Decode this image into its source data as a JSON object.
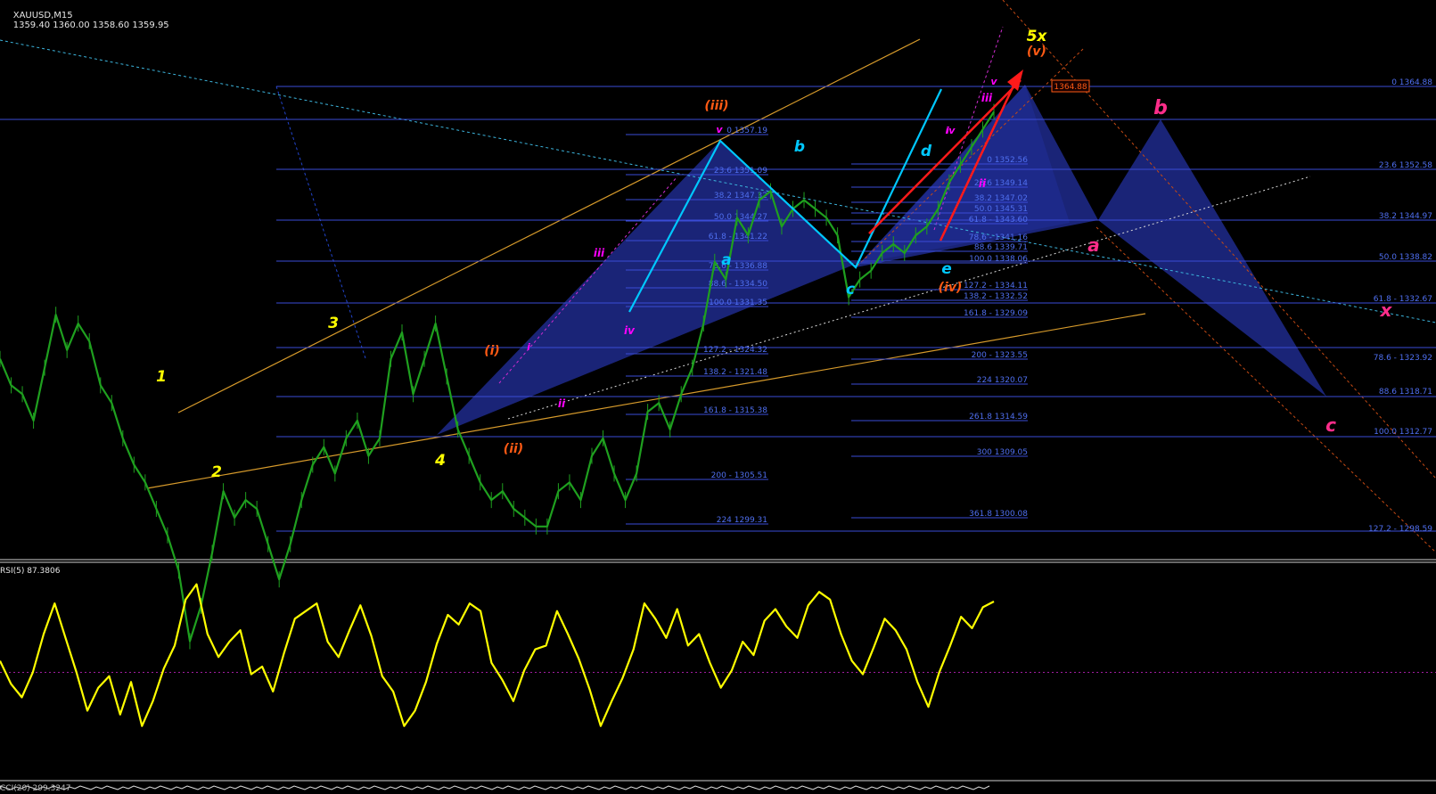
{
  "header": {
    "symbol_tf": "XAUUSD,M15",
    "ohlc": "1359.40 1360.00 1358.60 1359.95"
  },
  "rsi": {
    "label": "RSI(5) 87.3806"
  },
  "cci": {
    "label": "CCI(20) 299.3247"
  },
  "colors": {
    "background": "#000000",
    "candles": "#1fa01f",
    "fib": "#3a4bd6",
    "fib_text": "#4f6ff0",
    "fill": "#1e2a8c",
    "yellow_wave": "#ffff00",
    "orange_wave": "#ff5a14",
    "magenta_wave": "#ff00ff",
    "cyan_wave": "#00c8ff",
    "pink_wave": "#ff2d8a",
    "red_arrow": "#ff1a1a",
    "trendline": "#d69a2b",
    "rsi_line": "#ffff00"
  },
  "chart_data": {
    "type": "line",
    "symbol": "XAUUSD",
    "timeframe": "M15",
    "ohlc": {
      "open": 1359.4,
      "high": 1360.0,
      "low": 1358.6,
      "close": 1359.95
    },
    "ylim": [
      1295,
      1370
    ],
    "price_box": "1364.88",
    "price_series": [
      1334,
      1331,
      1330,
      1327,
      1333,
      1339,
      1335,
      1338,
      1336,
      1331,
      1329,
      1325,
      1322,
      1320,
      1317,
      1314,
      1310,
      1302,
      1306,
      1312,
      1319,
      1316,
      1318,
      1317,
      1313,
      1309,
      1313,
      1318,
      1322,
      1324,
      1321,
      1325,
      1327,
      1323,
      1325,
      1334,
      1337,
      1330,
      1334,
      1338,
      1332,
      1326,
      1323,
      1320,
      1318,
      1319,
      1317,
      1316,
      1315,
      1315,
      1319,
      1320,
      1318,
      1323,
      1325,
      1321,
      1318,
      1321,
      1328,
      1329,
      1326,
      1330,
      1333,
      1338,
      1345,
      1343,
      1350,
      1348,
      1352,
      1353,
      1349,
      1351,
      1352,
      1351,
      1350,
      1348,
      1341,
      1343,
      1344,
      1346,
      1347,
      1346,
      1348,
      1349,
      1351,
      1354,
      1356,
      1358,
      1360,
      1362
    ],
    "wave_labels": {
      "yellow": [
        "1",
        "2",
        "3",
        "4",
        "5x"
      ],
      "orange": [
        "(i)",
        "(ii)",
        "(iii)",
        "(iv)",
        "(v)"
      ],
      "magenta": [
        "i",
        "ii",
        "iii",
        "iv",
        "v",
        "i",
        "ii",
        "iii",
        "iv",
        "v"
      ],
      "cyan": [
        "a",
        "b",
        "c",
        "d",
        "e"
      ],
      "pink": [
        "a",
        "b",
        "c",
        "x"
      ]
    },
    "fib_sets": [
      {
        "id": "A",
        "levels": [
          "0 1357.19",
          "23.6 1351.09",
          "38.2 1347.32",
          "50.0 1344.27",
          "61.8 - 1341.22",
          "78.6 - 1336.88",
          "88.6 - 1334.50",
          "100.0 1331.35",
          "127.2 - 1324.32",
          "138.2 - 1321.48",
          "161.8 - 1315.38",
          "200 - 1305.51",
          "224 1299.31"
        ]
      },
      {
        "id": "B",
        "levels": [
          "0 1352.56",
          "23.6 1349.14",
          "38.2 1347.02",
          "50.0 1345.31",
          "61.8 - 1343.60",
          "78.6 - 1341.16",
          "88.6 1339.71",
          "100.0 1338.06",
          "127.2 - 1334.11",
          "138.2 - 1332.52",
          "161.8 - 1329.09",
          "200 - 1323.55",
          "224 1320.07",
          "261.8 1314.59",
          "300 1309.05",
          "361.8 1300.08"
        ]
      },
      {
        "id": "C",
        "levels": [
          "0 1364.88",
          "23.6 1352.58",
          "38.2 1344.97",
          "50.0 1338.82",
          "61.8 - 1332.67",
          "78.6 - 1323.92",
          "88.6 1318.71",
          "100.0 1312.77",
          "127.2 - 1298.59"
        ]
      }
    ],
    "rsi": {
      "name": "RSI(5)",
      "value": 87.3806,
      "ylim": [
        0,
        100
      ],
      "values": [
        56,
        44,
        37,
        50,
        70,
        86,
        68,
        50,
        30,
        42,
        48,
        28,
        45,
        22,
        35,
        52,
        64,
        88,
        96,
        70,
        58,
        66,
        72,
        49,
        53,
        40,
        60,
        78,
        82,
        86,
        66,
        58,
        72,
        85,
        69,
        48,
        40,
        22,
        30,
        45,
        65,
        80,
        75,
        86,
        82,
        55,
        46,
        35,
        51,
        62,
        64,
        82,
        70,
        57,
        41,
        22,
        35,
        47,
        62,
        86,
        78,
        68,
        83,
        64,
        70,
        55,
        42,
        51,
        66,
        59,
        77,
        83,
        74,
        68,
        85,
        92,
        88,
        70,
        56,
        49,
        63,
        78,
        72,
        62,
        45,
        32,
        50,
        64,
        79,
        73,
        84,
        87
      ]
    },
    "cci": {
      "name": "CCI(20)",
      "value": 299.3247
    }
  }
}
